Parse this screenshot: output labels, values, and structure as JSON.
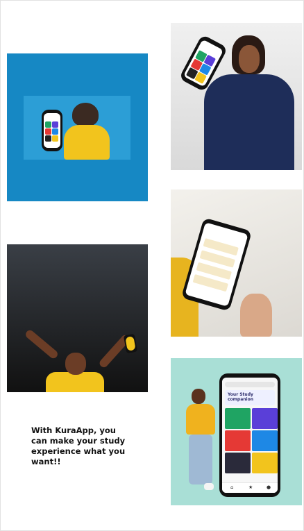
{
  "page": {
    "caption": "With KuraApp, you can make your study experience what you want!!"
  },
  "tiles": [
    {
      "name": "tile-woman-yellow-blue-bg"
    },
    {
      "name": "tile-woman-blue-dress"
    },
    {
      "name": "tile-hand-pointing-phone"
    },
    {
      "name": "tile-man-arms-up"
    },
    {
      "name": "tile-man-jumping-phone"
    }
  ],
  "phone_screen": {
    "title": "Your Study companion"
  },
  "colors": {
    "blue_bg": "#1688c4",
    "mint_bg": "#a9dfd6",
    "dark_bg": "#2e3339",
    "yellow": "#f2c41d"
  }
}
